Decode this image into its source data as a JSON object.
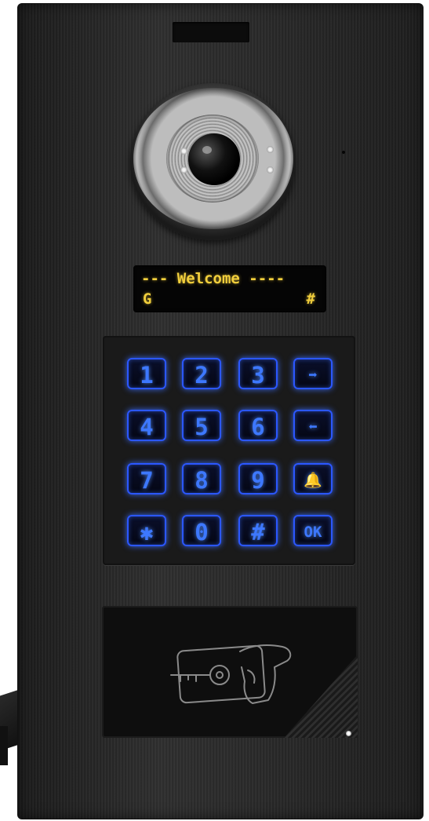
{
  "display": {
    "line1": "--- Welcome ----",
    "line2_left": "G",
    "line2_right": "#"
  },
  "keypad": {
    "keys": [
      {
        "label": "1"
      },
      {
        "label": "2"
      },
      {
        "label": "3"
      },
      {
        "label": "➡"
      },
      {
        "label": "4"
      },
      {
        "label": "5"
      },
      {
        "label": "6"
      },
      {
        "label": "⬅"
      },
      {
        "label": "7"
      },
      {
        "label": "8"
      },
      {
        "label": "9"
      },
      {
        "label": "🔔"
      },
      {
        "label": "✱"
      },
      {
        "label": "0"
      },
      {
        "label": "#"
      },
      {
        "label": "OK"
      }
    ]
  },
  "colors": {
    "display_text": "#f2cf3c",
    "key_glow": "#3d78ff",
    "panel": "#262626"
  },
  "icons": {
    "rfid": "card-key-hand-icon",
    "camera": "camera-lens-icon",
    "bell": "bell-icon",
    "arrow_right": "arrow-right-icon",
    "arrow_left": "arrow-left-icon"
  }
}
